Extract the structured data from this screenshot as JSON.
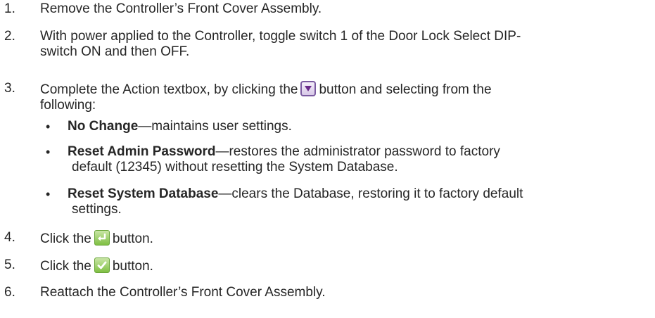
{
  "steps": [
    {
      "num": "1.",
      "text": "Remove the Controller’s Front Cover Assembly."
    },
    {
      "num": "2.",
      "line1": "With power applied to the Controller, toggle switch 1 of the Door Lock Select DIP-",
      "line2": "switch ON and then OFF."
    },
    {
      "num": "3.",
      "pre": "Complete the Action textbox, by clicking the",
      "post": "button and selecting from the",
      "line2": "following:"
    },
    {
      "num": "4.",
      "pre": "Click the",
      "post": "button."
    },
    {
      "num": "5.",
      "pre": "Click the",
      "post": "button."
    },
    {
      "num": "6.",
      "text": "Reattach the Controller’s Front Cover Assembly."
    }
  ],
  "bullets": [
    {
      "title": "No Change",
      "desc": "—maintains user settings."
    },
    {
      "title": "Reset Admin Password",
      "desc": "—restores the administrator password to factory",
      "line2": "default (12345) without resetting the System Database."
    },
    {
      "title": "Reset System Database",
      "desc": "—clears the Database, restoring it to factory default",
      "line2": "settings."
    }
  ],
  "bullet_glyph": "•",
  "icons": {
    "dropdown": "dropdown-arrow-icon",
    "enter": "enter-return-icon",
    "ok": "checkmark-icon"
  }
}
